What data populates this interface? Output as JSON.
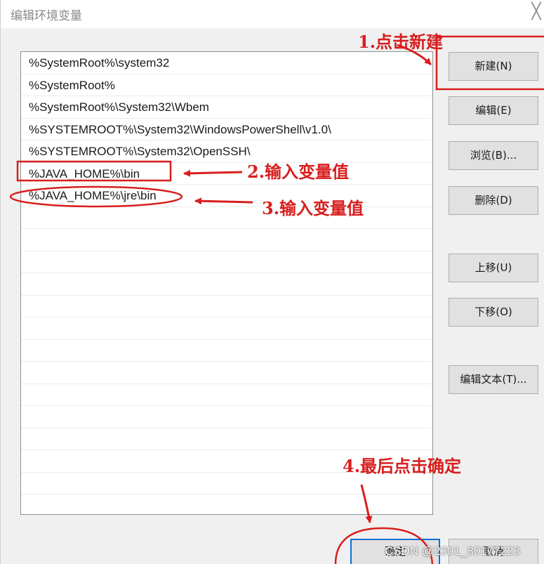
{
  "window": {
    "title": "编辑环境变量",
    "close_glyph": "╳"
  },
  "path_list": {
    "items": [
      "%SystemRoot%\\system32",
      "%SystemRoot%",
      "%SystemRoot%\\System32\\Wbem",
      "%SYSTEMROOT%\\System32\\WindowsPowerShell\\v1.0\\",
      "%SYSTEMROOT%\\System32\\OpenSSH\\",
      "%JAVA_HOME%\\bin",
      "%JAVA_HOME%\\jre\\bin"
    ]
  },
  "buttons": {
    "new": "新建(N)",
    "edit": "编辑(E)",
    "browse": "浏览(B)...",
    "delete": "删除(D)",
    "move_up": "上移(U)",
    "move_down": "下移(O)",
    "edit_text": "编辑文本(T)...",
    "ok": "确定",
    "cancel": "取消"
  },
  "annotations": {
    "step1": "1.点击新建",
    "step2": "2.输入变量值",
    "step3": "3.输入变量值",
    "step4": "4.最后点击确定"
  },
  "watermark": "CSDN @2301_80177223",
  "colors": {
    "annotation_red": "#d81e1e",
    "focus_blue": "#0a6fd6",
    "button_face": "#e1e1e1",
    "dialog_bg": "#f0f0f0"
  }
}
